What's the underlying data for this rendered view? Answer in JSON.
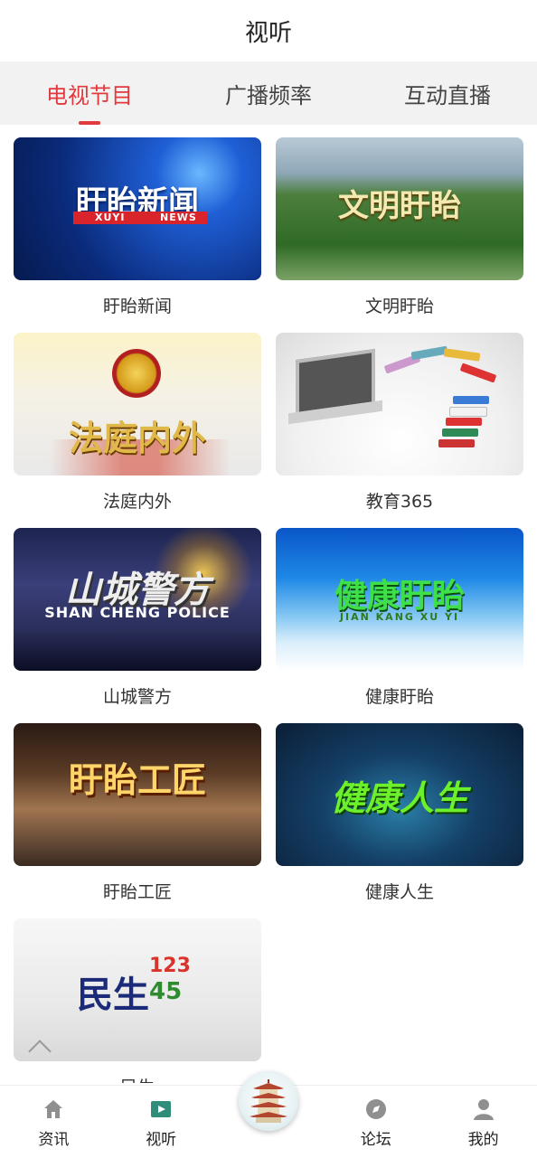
{
  "header": {
    "title": "视听"
  },
  "tabs": [
    {
      "label": "电视节目",
      "active": true
    },
    {
      "label": "广播频率",
      "active": false
    },
    {
      "label": "互动直播",
      "active": false
    }
  ],
  "programs": [
    {
      "caption": "盱眙新闻",
      "art_title": "盱眙新闻",
      "art_sub_left": "XUYI",
      "art_sub_right": "NEWS"
    },
    {
      "caption": "文明盱眙",
      "art_title": "文明盱眙"
    },
    {
      "caption": "法庭内外",
      "art_title": "法庭内外"
    },
    {
      "caption": "教育365"
    },
    {
      "caption": "山城警方",
      "art_title": "山城警方",
      "art_sub": "SHAN CHENG POLICE"
    },
    {
      "caption": "健康盱眙",
      "art_title": "健康盱眙",
      "art_sub": "JIAN KANG XU YI"
    },
    {
      "caption": "盱眙工匠",
      "art_title": "盱眙工匠"
    },
    {
      "caption": "健康人生",
      "art_title": "健康人生"
    },
    {
      "caption": "民生",
      "art_title": "民生",
      "art_num_top": "123",
      "art_num_bottom": "45"
    }
  ],
  "tabbar": [
    {
      "label": "资讯",
      "icon": "home-icon"
    },
    {
      "label": "视听",
      "icon": "video-icon"
    },
    {
      "label": "",
      "icon": "pagoda-logo-icon"
    },
    {
      "label": "论坛",
      "icon": "compass-icon"
    },
    {
      "label": "我的",
      "icon": "user-icon"
    }
  ],
  "colors": {
    "accent": "#e0393e",
    "tab_bg": "#f2f2f2",
    "icon_gray": "#8f8f8f",
    "video_icon": "#2f8d7a"
  }
}
